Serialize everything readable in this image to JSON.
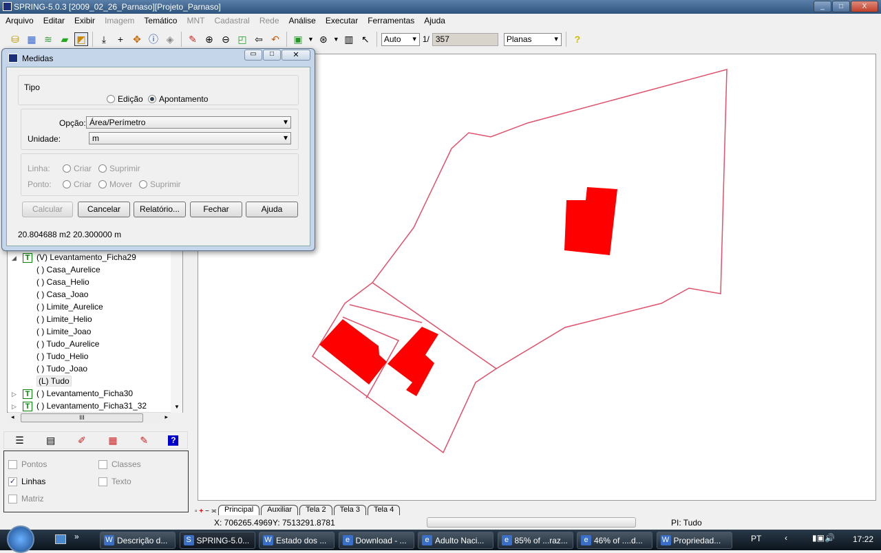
{
  "window": {
    "title": "SPRING-5.0.3 [2009_02_26_Parnaso][Projeto_Parnaso]",
    "controls": [
      "_",
      "□",
      "X"
    ]
  },
  "menu": [
    {
      "label": "Arquivo",
      "enabled": true
    },
    {
      "label": "Editar",
      "enabled": true
    },
    {
      "label": "Exibir",
      "enabled": true
    },
    {
      "label": "Imagem",
      "enabled": false
    },
    {
      "label": "Temático",
      "enabled": true
    },
    {
      "label": "MNT",
      "enabled": false
    },
    {
      "label": "Cadastral",
      "enabled": false
    },
    {
      "label": "Rede",
      "enabled": false
    },
    {
      "label": "Análise",
      "enabled": true
    },
    {
      "label": "Executar",
      "enabled": true
    },
    {
      "label": "Ferramentas",
      "enabled": true
    },
    {
      "label": "Ajuda",
      "enabled": true
    }
  ],
  "toolbar": {
    "scale_mode": "Auto",
    "scale_prefix": "1/",
    "scale_value": "357",
    "projection": "Planas",
    "icons": [
      "database-icon",
      "model-icon",
      "layers-icon",
      "plane-icon",
      "display-icon",
      "import-icon",
      "plus-icon",
      "pan-icon",
      "info-icon",
      "tag-icon",
      "pencil-icon",
      "zoom-in-icon",
      "zoom-out-icon",
      "zoom-area-icon",
      "back-icon",
      "undo-icon",
      "draw-mode-icon",
      "zoom-scale-icon",
      "histogram-icon",
      "cursor-icon",
      "help-icon"
    ]
  },
  "dialog": {
    "title": "Medidas",
    "tipo_label": "Tipo",
    "tipo_options": [
      "Edição",
      "Apontamento"
    ],
    "tipo_selected": "Apontamento",
    "opcao_label": "Opção:",
    "opcao_value": "Área/Perímetro",
    "unidade_label": "Unidade:",
    "unidade_value": "m",
    "linha_label": "Linha:",
    "linha_options": [
      "Criar",
      "Suprimir"
    ],
    "ponto_label": "Ponto:",
    "ponto_options": [
      "Criar",
      "Mover",
      "Suprimir"
    ],
    "buttons": {
      "calcular": "Calcular",
      "cancelar": "Cancelar",
      "relatorio": "Relatório...",
      "fechar": "Fechar",
      "ajuda": "Ajuda"
    },
    "result": "20.804688 m2 20.300000 m"
  },
  "tree": {
    "parent": "(V) Levantamento_Ficha29",
    "children": [
      "( ) Casa_Aurelice",
      "( ) Casa_Helio",
      "( ) Casa_Joao",
      "( ) Limite_Aurelice",
      "( ) Limite_Helio",
      "( ) Limite_Joao",
      "( ) Tudo_Aurelice",
      "( ) Tudo_Helio",
      "( ) Tudo_Joao",
      "(L) Tudo"
    ],
    "siblings": [
      "( ) Levantamento_Ficha30",
      "( ) Levantamento_Ficha31_32"
    ],
    "hscroll_thumb": "III"
  },
  "display_options": {
    "pontos": {
      "label": "Pontos",
      "checked": false
    },
    "classes": {
      "label": "Classes",
      "checked": false
    },
    "linhas": {
      "label": "Linhas",
      "checked": true
    },
    "texto": {
      "label": "Texto",
      "checked": false
    },
    "matriz": {
      "label": "Matriz",
      "checked": false
    }
  },
  "tabs": [
    "Principal",
    "Auxiliar",
    "Tela 2",
    "Tela 3",
    "Tela 4"
  ],
  "tabs_active": "Principal",
  "status": {
    "x": "X: 706265.4969",
    "y": "Y: 7513291.8781",
    "pi": "PI: Tudo"
  },
  "colors": {
    "polygon_line": "#e0506a",
    "polygon_fill": "#ff0000"
  },
  "taskbar": {
    "items": [
      "Descrição d...",
      "SPRING-5.0...",
      "Estado dos ...",
      "Download - ...",
      "Adulto Naci...",
      "85% of ...raz...",
      "46% of ....d...",
      "Propriedad..."
    ],
    "lang": "PT",
    "clock": "17:22"
  }
}
